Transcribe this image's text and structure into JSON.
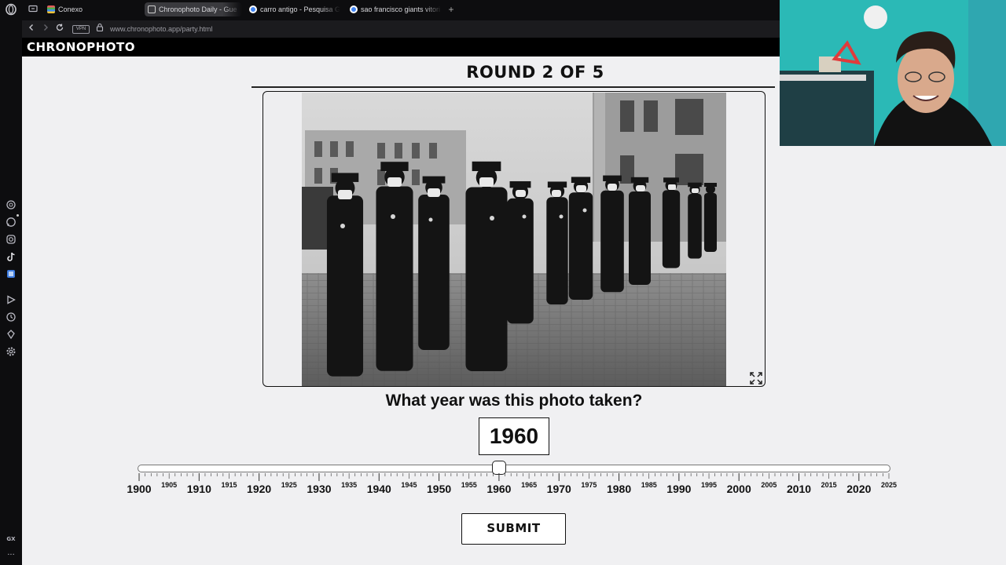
{
  "browser": {
    "tabs": [
      {
        "label": "Conexo",
        "icon": "stack-icon",
        "active": false
      },
      {
        "label": "Chronophoto Daily - Gue",
        "icon": "camera-icon",
        "active": true
      },
      {
        "label": "carro antigo - Pesquisa G",
        "icon": "google-icon",
        "active": false
      },
      {
        "label": "sao francisco giants vitori",
        "icon": "google-icon",
        "active": false
      }
    ],
    "new_tab": "+",
    "vpn_label": "VPN",
    "url": "www.chronophoto.app/party.html",
    "sidebar_bottom_label": "GX",
    "sidebar_more": "···"
  },
  "site": {
    "logo": "CHRONOPHOTO"
  },
  "game": {
    "round_title": "ROUND 2 OF 5",
    "question": "What year was this photo taken?",
    "year_value": "1960",
    "slider": {
      "min": 1900,
      "max": 2025,
      "value": 1960
    },
    "major_labels": [
      "1900",
      "1910",
      "1920",
      "1930",
      "1940",
      "1950",
      "1960",
      "1970",
      "1980",
      "1990",
      "2000",
      "2010",
      "2020"
    ],
    "minor_labels": [
      "1905",
      "1915",
      "1925",
      "1935",
      "1945",
      "1955",
      "1965",
      "1975",
      "1985",
      "1995",
      "2005",
      "2015",
      "2025"
    ],
    "submit_label": "SUBMIT"
  },
  "photo": {
    "subject": "black-and-white photograph of uniformed police officers wearing face masks standing in a row on a cobblestone street"
  }
}
